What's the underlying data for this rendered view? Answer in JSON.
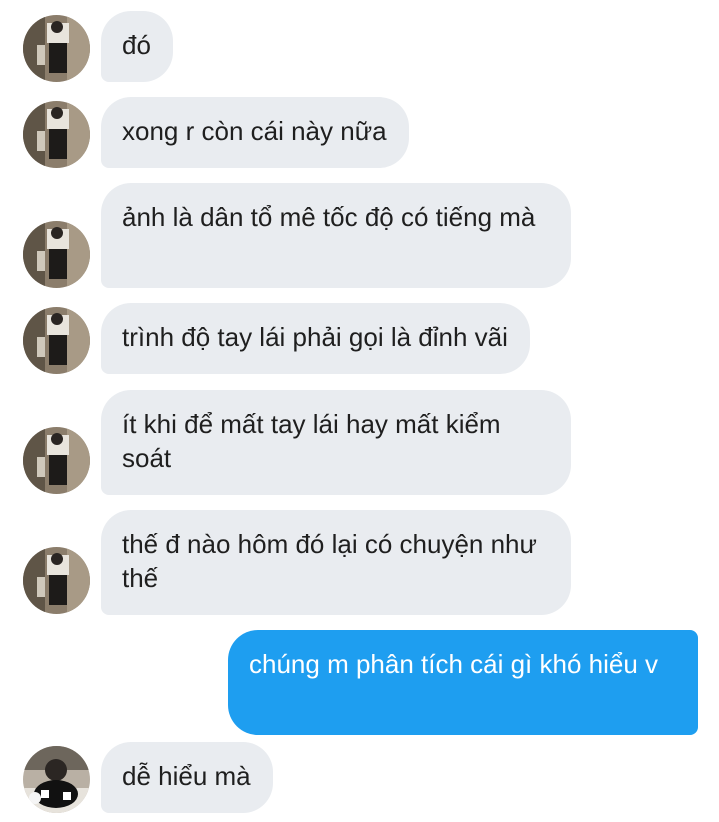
{
  "conversation": {
    "messages": [
      {
        "direction": "incoming",
        "text": "đó"
      },
      {
        "direction": "incoming",
        "text": "xong r còn cái này nữa"
      },
      {
        "direction": "incoming",
        "text": "ảnh là dân tổ mê tốc độ có tiếng mà"
      },
      {
        "direction": "incoming",
        "text": "trình độ tay lái phải gọi là đỉnh vãi"
      },
      {
        "direction": "incoming",
        "text": "ít khi để mất tay lái hay mất kiểm soát"
      },
      {
        "direction": "incoming",
        "text": "thế đ nào hôm đó lại có chuyện như thế"
      },
      {
        "direction": "outgoing",
        "text": "chúng m phân tích cái gì khó hiểu v"
      },
      {
        "direction": "incoming",
        "text": "dễ hiểu mà"
      }
    ]
  },
  "colors": {
    "incoming_bubble": "#e9ecf0",
    "outgoing_bubble": "#1e9ef0",
    "incoming_text": "#1f1f1f",
    "outgoing_text": "#ffffff"
  }
}
